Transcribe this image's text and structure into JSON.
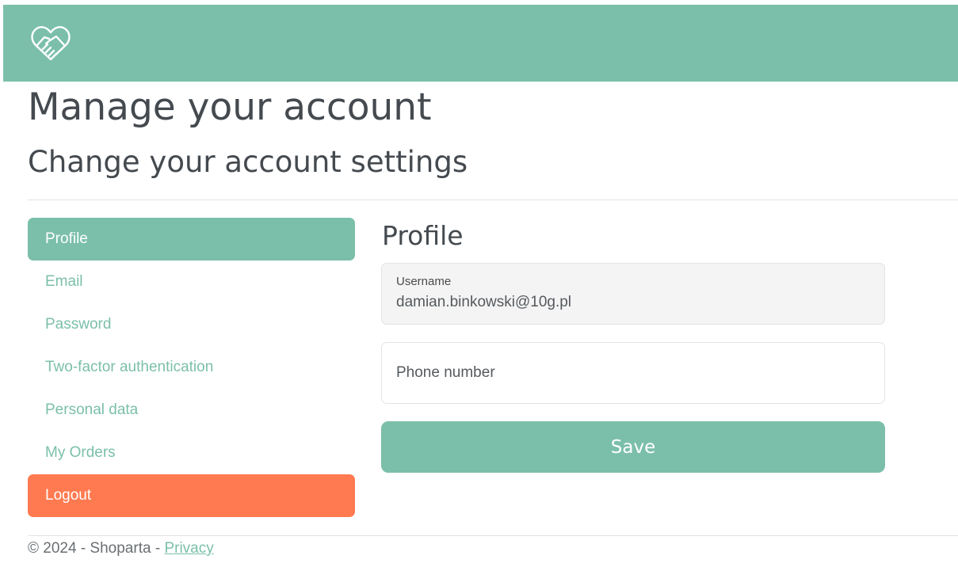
{
  "header": {
    "logo_icon": "handshake-heart-icon",
    "background_color": "#7bbfaa"
  },
  "page": {
    "title": "Manage your account",
    "subtitle": "Change your account settings"
  },
  "sidebar": {
    "items": [
      {
        "label": "Profile",
        "state": "active"
      },
      {
        "label": "Email",
        "state": "default"
      },
      {
        "label": "Password",
        "state": "default"
      },
      {
        "label": "Two-factor authentication",
        "state": "default"
      },
      {
        "label": "Personal data",
        "state": "default"
      },
      {
        "label": "My Orders",
        "state": "default"
      },
      {
        "label": "Logout",
        "state": "danger"
      }
    ],
    "accent_color": "#7bbfaa",
    "logout_color": "#ff7a50"
  },
  "profile": {
    "section_title": "Profile",
    "username_label": "Username",
    "username_value": "damian.binkowski@10g.pl",
    "phone_placeholder": "Phone number",
    "save_label": "Save"
  },
  "footer": {
    "copyright": "© 2024 - Shoparta - ",
    "privacy_label": "Privacy"
  }
}
